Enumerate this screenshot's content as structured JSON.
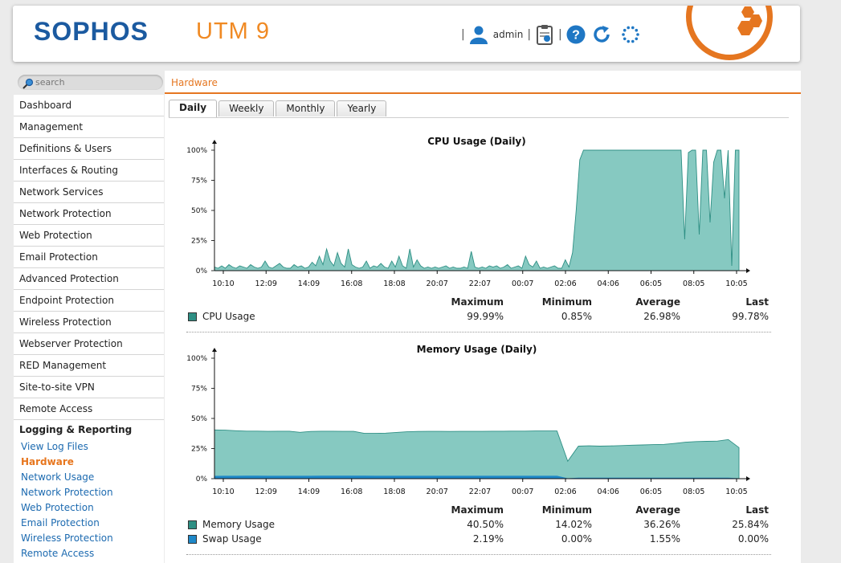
{
  "header": {
    "brand": "SOPHOS",
    "product": "UTM 9",
    "user": "admin",
    "icons": [
      "user-icon",
      "clipboard-icon",
      "help-icon",
      "refresh-icon",
      "spinner-icon"
    ]
  },
  "search": {
    "placeholder": "search"
  },
  "nav": {
    "items": [
      "Dashboard",
      "Management",
      "Definitions & Users",
      "Interfaces & Routing",
      "Network Services",
      "Network Protection",
      "Web Protection",
      "Email Protection",
      "Advanced Protection",
      "Endpoint Protection",
      "Wireless Protection",
      "Webserver Protection",
      "RED Management",
      "Site-to-site VPN",
      "Remote Access"
    ],
    "section": "Logging & Reporting",
    "subitems": [
      "View Log Files",
      "Hardware",
      "Network Usage",
      "Network Protection",
      "Web Protection",
      "Email Protection",
      "Wireless Protection",
      "Remote Access"
    ],
    "active_sub": "Hardware"
  },
  "breadcrumb": "Hardware",
  "tabs": [
    "Daily",
    "Weekly",
    "Monthly",
    "Yearly"
  ],
  "active_tab": "Daily",
  "colors": {
    "accent": "#e57620",
    "brand": "#1b5aa0",
    "cpu_fill": "#86c9c1",
    "cpu_line": "#2e8f84",
    "swap": "#1e88c8"
  },
  "chart_data": [
    {
      "type": "area",
      "title": "CPU Usage (Daily)",
      "xticks": [
        "10:10",
        "12:09",
        "14:09",
        "16:08",
        "18:08",
        "20:07",
        "22:07",
        "00:07",
        "02:06",
        "04:06",
        "06:05",
        "08:05",
        "10:05"
      ],
      "yticks": [
        "0%",
        "25%",
        "50%",
        "75%",
        "100%"
      ],
      "ylim": [
        0,
        100
      ],
      "series": [
        {
          "name": "CPU Usage",
          "color": "#2e8f84",
          "values": [
            3,
            2,
            4,
            2,
            5,
            3,
            2,
            4,
            3,
            2,
            5,
            3,
            2,
            3,
            8,
            3,
            2,
            4,
            6,
            3,
            2,
            2,
            5,
            3,
            4,
            2,
            3,
            7,
            4,
            12,
            5,
            18,
            8,
            4,
            15,
            6,
            3,
            18,
            5,
            3,
            2,
            3,
            8,
            2,
            4,
            3,
            6,
            3,
            2,
            8,
            3,
            12,
            4,
            2,
            18,
            3,
            9,
            4,
            2,
            3,
            2,
            3,
            2,
            3,
            4,
            2,
            3,
            2,
            2,
            3,
            2,
            16,
            3,
            2,
            3,
            2,
            4,
            3,
            4,
            2,
            3,
            5,
            2,
            3,
            4,
            2,
            12,
            5,
            3,
            8,
            2,
            3,
            2,
            3,
            4,
            2,
            2,
            9,
            3,
            15,
            50,
            92,
            100,
            100,
            100,
            100,
            100,
            100,
            100,
            100,
            100,
            100,
            100,
            100,
            100,
            100,
            100,
            100,
            100,
            100,
            100,
            100,
            100,
            100,
            100,
            100,
            100,
            100,
            100,
            100,
            26,
            98,
            100,
            100,
            30,
            100,
            100,
            40,
            90,
            100,
            100,
            60,
            100,
            4,
            100,
            100
          ]
        }
      ],
      "stats": {
        "headers": [
          "Maximum",
          "Minimum",
          "Average",
          "Last"
        ],
        "rows": [
          {
            "name": "CPU Usage",
            "color": "#2e8f84",
            "values": [
              "99.99%",
              "0.85%",
              "26.98%",
              "99.78%"
            ]
          }
        ]
      }
    },
    {
      "type": "area",
      "title": "Memory Usage (Daily)",
      "xticks": [
        "10:10",
        "12:09",
        "14:09",
        "16:08",
        "18:08",
        "20:07",
        "22:07",
        "00:07",
        "02:06",
        "04:06",
        "06:05",
        "08:05",
        "10:05"
      ],
      "yticks": [
        "0%",
        "25%",
        "50%",
        "75%",
        "100%"
      ],
      "ylim": [
        0,
        100
      ],
      "series": [
        {
          "name": "Memory Usage",
          "color": "#2e8f84",
          "values": [
            40.5,
            40.3,
            39.8,
            39.5,
            39.5,
            39.3,
            39.4,
            39.4,
            38.5,
            39.2,
            39.4,
            39.4,
            39.3,
            39.3,
            37.6,
            37.6,
            37.8,
            38.4,
            38.9,
            39.2,
            39.3,
            39.3,
            39.2,
            39.3,
            39.3,
            39.3,
            39.4,
            39.4,
            39.5,
            39.5,
            39.6,
            39.6,
            39.6,
            14.5,
            27.0,
            27.3,
            27.0,
            27.2,
            27.5,
            27.8,
            28.0,
            28.3,
            28.5,
            29.3,
            30.3,
            30.8,
            31.0,
            31.2,
            32.5,
            25.8
          ]
        },
        {
          "name": "Swap Usage",
          "color": "#1e88c8",
          "values": [
            2.0,
            2.1,
            2.1,
            2.2,
            2.2,
            2.1,
            2.1,
            2.1,
            2.1,
            2.1,
            2.2,
            2.2,
            2.2,
            2.2,
            2.2,
            2.1,
            2.1,
            2.1,
            2.1,
            2.1,
            2.1,
            2.1,
            2.1,
            2.1,
            2.1,
            2.1,
            2.1,
            2.1,
            2.1,
            2.1,
            2.1,
            2.1,
            2.1,
            0.0,
            0.5,
            0.5,
            0.5,
            0.5,
            0.5,
            0.5,
            0.5,
            0.5,
            0.5,
            0.5,
            0.5,
            0.5,
            0.5,
            0.5,
            0.5,
            0.0
          ]
        }
      ],
      "stats": {
        "headers": [
          "Maximum",
          "Minimum",
          "Average",
          "Last"
        ],
        "rows": [
          {
            "name": "Memory Usage",
            "color": "#2e8f84",
            "values": [
              "40.50%",
              "14.02%",
              "36.26%",
              "25.84%"
            ]
          },
          {
            "name": "Swap Usage",
            "color": "#1e88c8",
            "values": [
              "2.19%",
              "0.00%",
              "1.55%",
              "0.00%"
            ]
          }
        ]
      }
    }
  ]
}
